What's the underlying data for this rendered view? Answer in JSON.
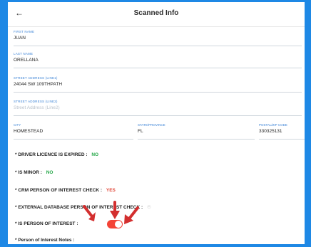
{
  "header": {
    "back_icon": "←",
    "title": "Scanned Info"
  },
  "fields": {
    "first_name": {
      "label": "FIRST NAME",
      "value": "JUAN"
    },
    "last_name": {
      "label": "LAST NAME",
      "value": "ORELLANA"
    },
    "street1": {
      "label": "STREET ADDRESS (LINE1)",
      "value": "24044 SW 109THPATH"
    },
    "street2": {
      "label": "STREET ADDRESS (LINE2)",
      "placeholder": "Street Address (Line2)"
    },
    "city": {
      "label": "CITY",
      "value": "HOMESTEAD"
    },
    "state": {
      "label": "STATE/PROVINCE",
      "value": "FL"
    },
    "postal": {
      "label": "POSTAL/ZIP CODE",
      "value": "330325131"
    }
  },
  "checks": {
    "licence_expired": {
      "label": "* DRIVER LICENCE IS EXPIRED :",
      "result": "NO"
    },
    "is_minor": {
      "label": "* IS MINOR :",
      "result": "NO"
    },
    "crm_poi": {
      "label": "* CRM PERSON OF INTEREST CHECK :",
      "result": "YES"
    },
    "external_db_poi": {
      "label": "* EXTERNAL DATABASE PERSON OF INTEREST CHECK :",
      "result": "☉"
    },
    "is_poi": {
      "label": "* IS PERSON OF INTEREST :"
    },
    "poi_notes": {
      "label": "* Person of Interest Notes :"
    }
  },
  "toggle": {
    "state": "on",
    "color": "#f44336"
  },
  "colors": {
    "frame": "#1e88e5",
    "label_blue": "#3a82d6",
    "no_green": "#27a84a",
    "yes_red": "#e24a3b",
    "arrow_red": "#d32f2f"
  },
  "annotations": {
    "arrow_icon": "red-arrow-icon"
  }
}
